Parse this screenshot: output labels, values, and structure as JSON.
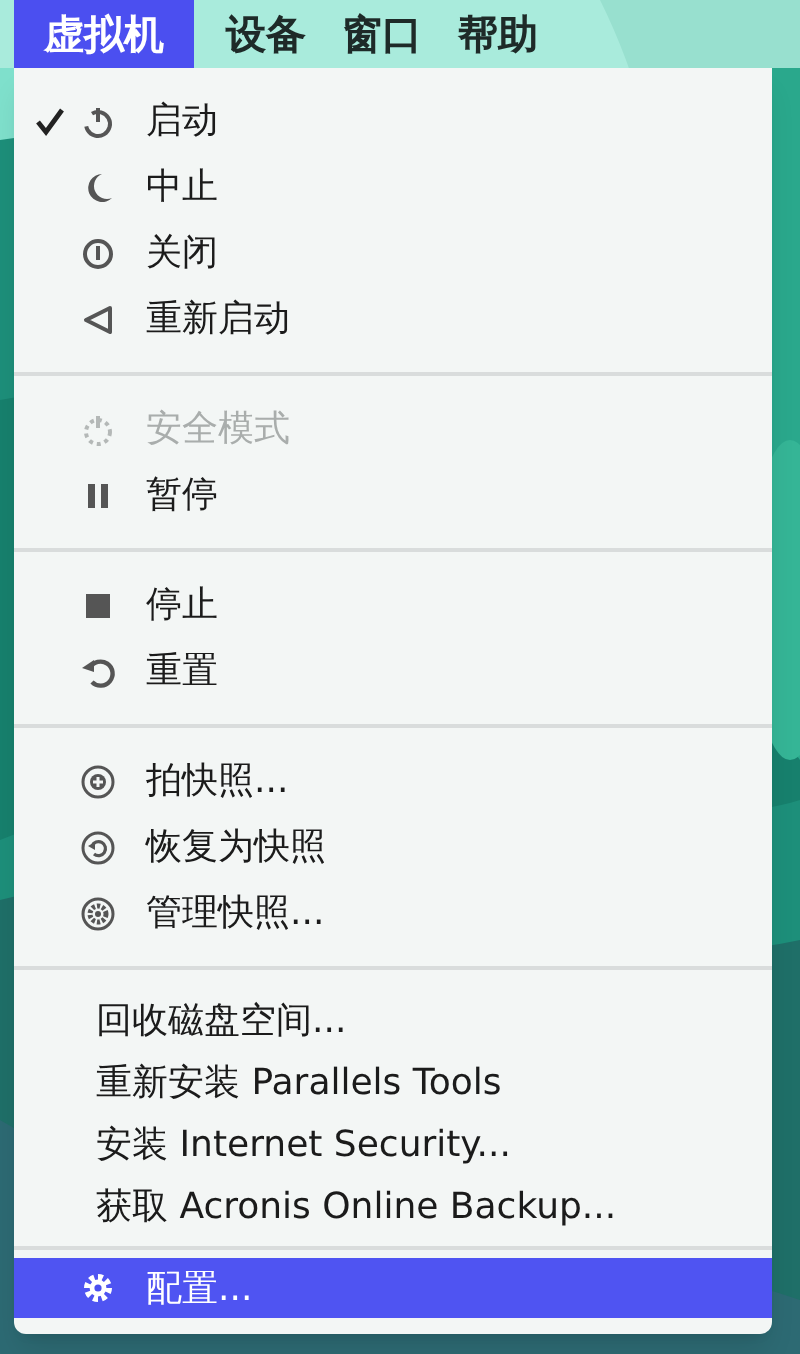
{
  "menubar": [
    {
      "label": "虚拟机",
      "selected": true
    },
    {
      "label": "设备",
      "selected": false
    },
    {
      "label": "窗口",
      "selected": false
    },
    {
      "label": "帮助",
      "selected": false
    }
  ],
  "menu": {
    "groups": [
      {
        "items": [
          {
            "label": "启动",
            "kind": "power",
            "checked": true,
            "disabled": false,
            "selected": false
          },
          {
            "label": "中止",
            "kind": "moon",
            "checked": false,
            "disabled": false,
            "selected": false
          },
          {
            "label": "关闭",
            "kind": "shutdown",
            "checked": false,
            "disabled": false,
            "selected": false
          },
          {
            "label": "重新启动",
            "kind": "restart",
            "checked": false,
            "disabled": false,
            "selected": false
          }
        ]
      },
      {
        "items": [
          {
            "label": "安全模式",
            "kind": "safe-mode",
            "checked": false,
            "disabled": true,
            "selected": false
          },
          {
            "label": "暂停",
            "kind": "pause",
            "checked": false,
            "disabled": false,
            "selected": false
          }
        ]
      },
      {
        "items": [
          {
            "label": "停止",
            "kind": "stop",
            "checked": false,
            "disabled": false,
            "selected": false
          },
          {
            "label": "重置",
            "kind": "reset",
            "checked": false,
            "disabled": false,
            "selected": false
          }
        ]
      },
      {
        "items": [
          {
            "label": "拍快照...",
            "kind": "snapshot",
            "checked": false,
            "disabled": false,
            "selected": false
          },
          {
            "label": "恢复为快照",
            "kind": "revert",
            "checked": false,
            "disabled": false,
            "selected": false
          },
          {
            "label": "管理快照...",
            "kind": "manage",
            "checked": false,
            "disabled": false,
            "selected": false
          }
        ]
      },
      {
        "items": [
          {
            "label": "回收磁盘空间...",
            "checked": false,
            "disabled": false,
            "selected": false
          },
          {
            "label": "重新安装 Parallels Tools",
            "checked": false,
            "disabled": false,
            "selected": false
          },
          {
            "label": "安装 Internet Security...",
            "checked": false,
            "disabled": false,
            "selected": false
          },
          {
            "label": "获取 Acronis Online Backup...",
            "checked": false,
            "disabled": false,
            "selected": false
          }
        ]
      },
      {
        "items": [
          {
            "label": "配置...",
            "kind": "configure",
            "checked": false,
            "disabled": false,
            "selected": true
          }
        ]
      }
    ]
  }
}
